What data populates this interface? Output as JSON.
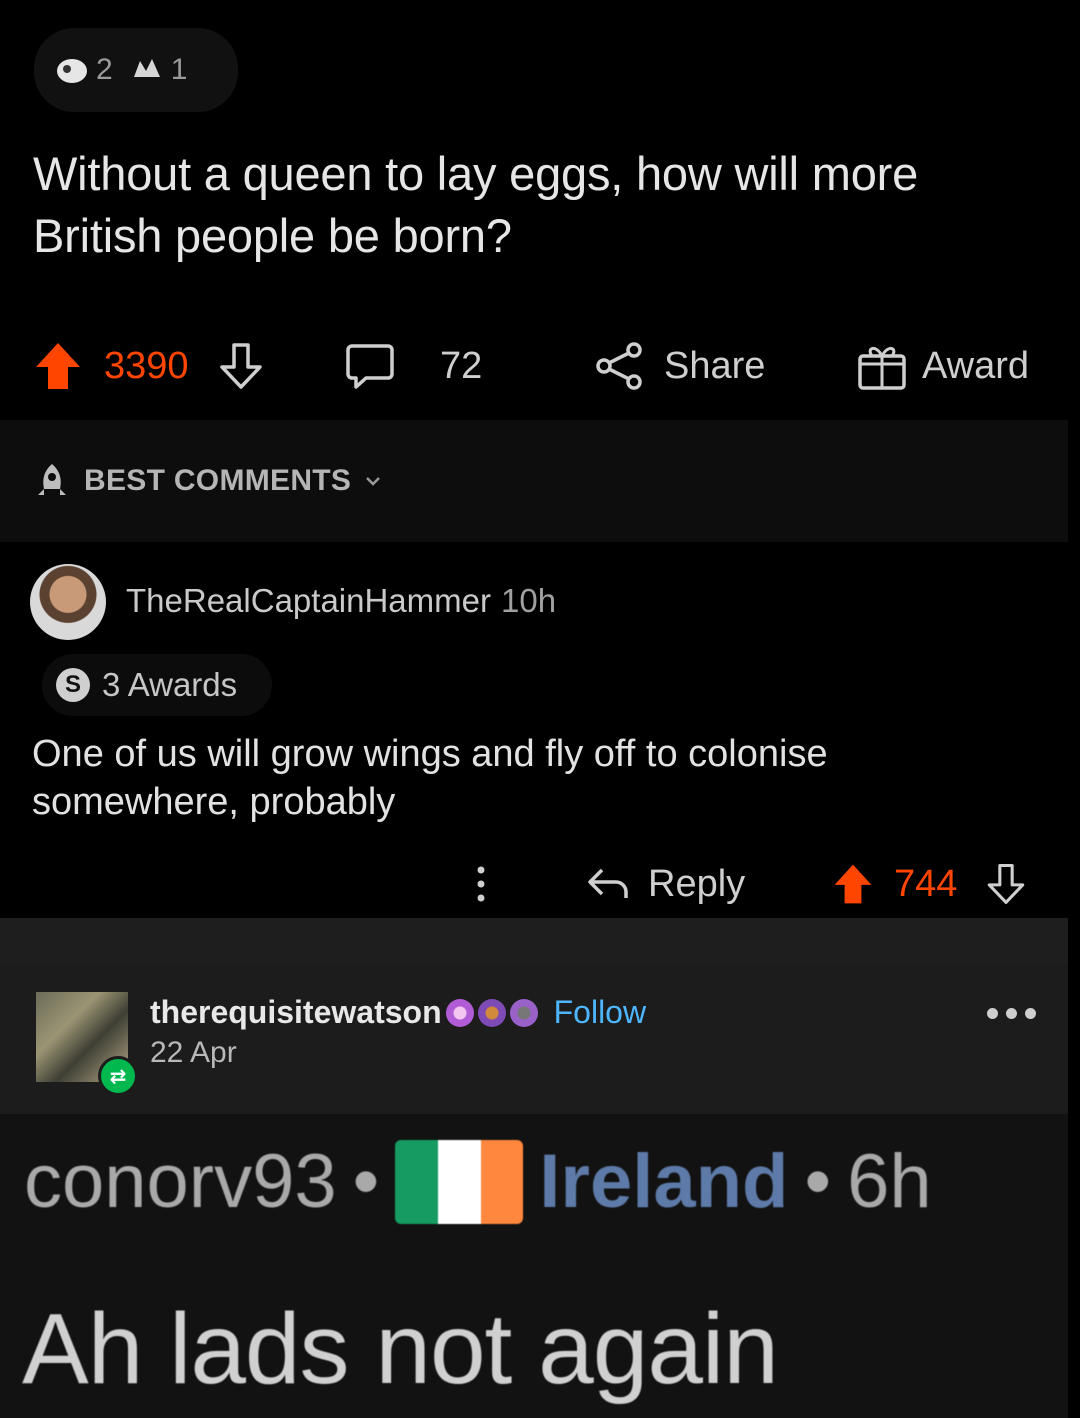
{
  "post": {
    "awards": [
      {
        "icon": "trophy-award-icon",
        "count": "2"
      },
      {
        "icon": "wholesome-award-icon",
        "count": "1"
      }
    ],
    "title": "Without a queen to lay eggs, how will more British people be born?",
    "score": "3390",
    "comments_count": "72",
    "share_label": "Share",
    "award_label": "Award"
  },
  "sort": {
    "label": "BEST COMMENTS",
    "icon": "rocket-icon"
  },
  "comment": {
    "username": "TheRealCaptainHammer",
    "time": "10h",
    "awards_label": "3 Awards",
    "award_icon_letter": "S",
    "body": "One of us will grow wings and fly off to colonise somewhere, probably",
    "reply_label": "Reply",
    "score": "744"
  },
  "tumblr": {
    "username": "therequisitewatson",
    "follow_label": "Follow",
    "date": "22 Apr"
  },
  "bottom": {
    "user": "conorv93",
    "sep1": "•",
    "country": "Ireland",
    "sep2": "•",
    "time": "6h",
    "text": "Ah lads not again"
  },
  "colors": {
    "upvote": "#ff4500",
    "follow": "#4db6ff",
    "flag_green": "#169b62",
    "flag_white": "#ffffff",
    "flag_orange": "#ff883e"
  }
}
